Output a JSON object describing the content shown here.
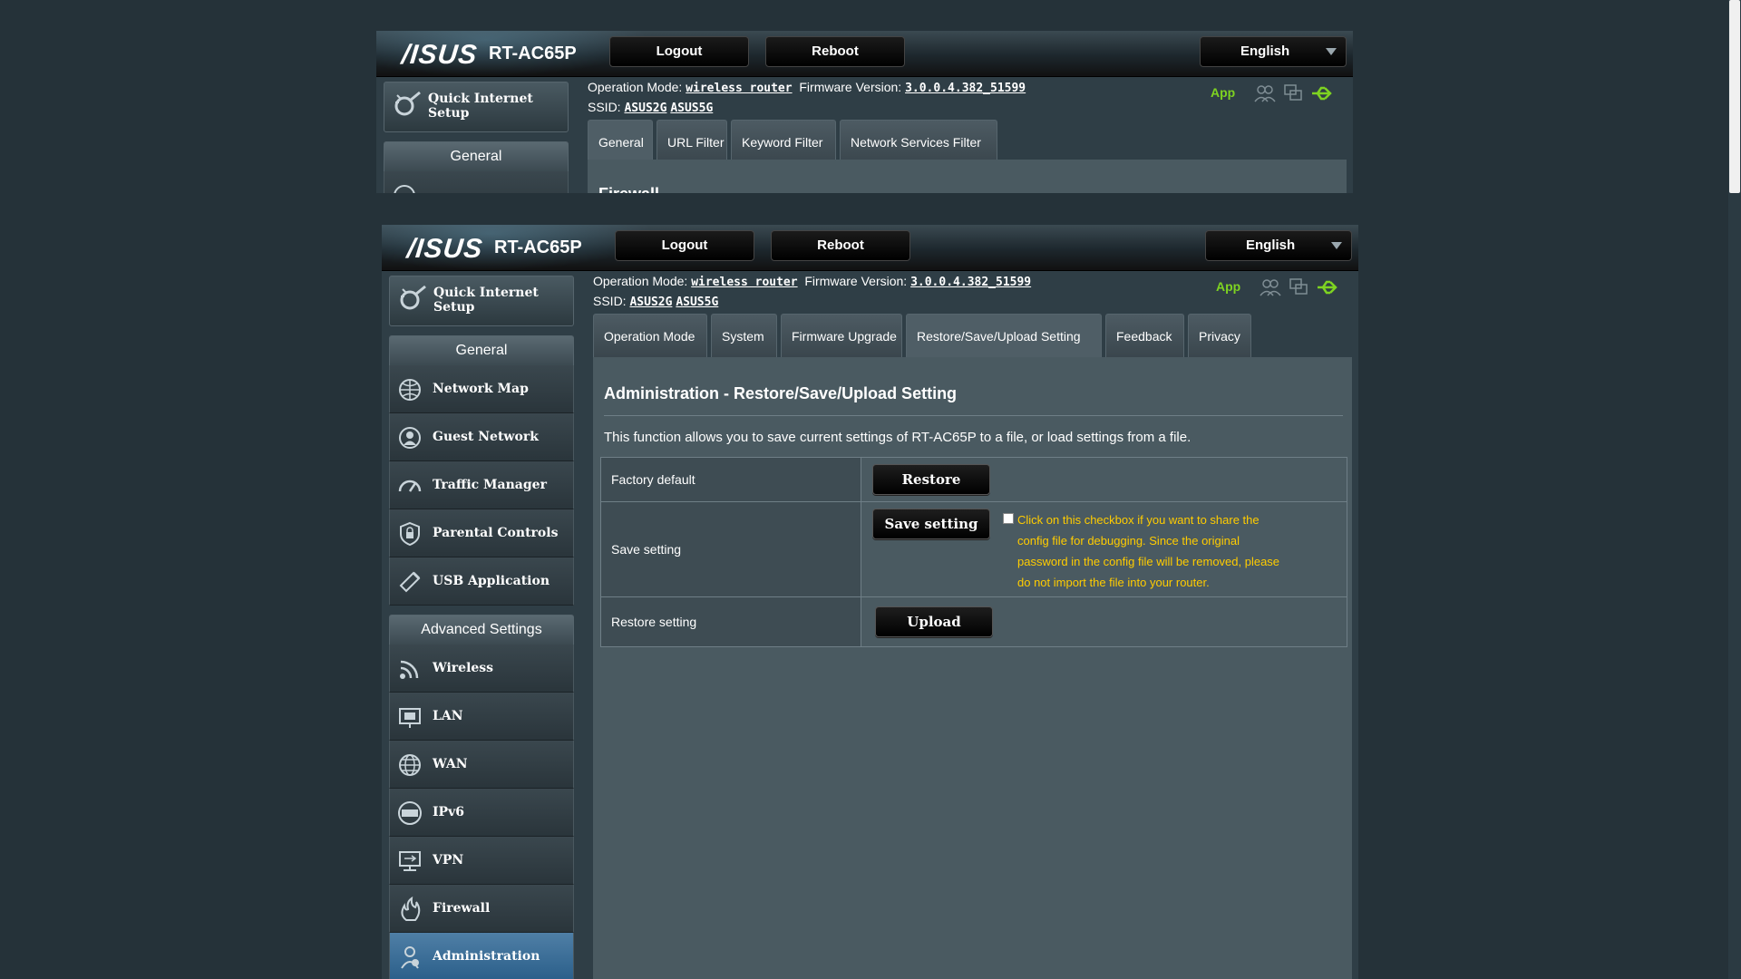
{
  "header": {
    "logo": "/ISUS",
    "model": "RT-AC65P",
    "logout_label": "Logout",
    "reboot_label": "Reboot",
    "language": "English"
  },
  "status": {
    "operation_mode_label": "Operation Mode:",
    "operation_mode_value": "wireless router",
    "firmware_label": "Firmware Version:",
    "firmware_value": "3.0.0.4.382_51599",
    "ssid_label": "SSID:",
    "ssid_1": "ASUS2G",
    "ssid_2": "ASUS5G",
    "app_label": "App"
  },
  "colors": {
    "accent_green": "#7ed321",
    "warning_yellow": "#ffcc00",
    "active_blue": "#2b5f8a"
  },
  "sidebar": {
    "quick_setup": "Quick Internet Setup",
    "general_head": "General",
    "general_items": [
      {
        "label": "Network Map",
        "icon": "network-map-icon"
      },
      {
        "label": "Guest Network",
        "icon": "guest-network-icon"
      },
      {
        "label": "Traffic Manager",
        "icon": "traffic-manager-icon"
      },
      {
        "label": "Parental Controls",
        "icon": "parental-controls-icon"
      },
      {
        "label": "USB Application",
        "icon": "usb-application-icon"
      }
    ],
    "advanced_head": "Advanced Settings",
    "advanced_items": [
      {
        "label": "Wireless",
        "icon": "wireless-icon"
      },
      {
        "label": "LAN",
        "icon": "lan-icon"
      },
      {
        "label": "WAN",
        "icon": "wan-icon"
      },
      {
        "label": "IPv6",
        "icon": "ipv6-icon"
      },
      {
        "label": "VPN",
        "icon": "vpn-icon"
      },
      {
        "label": "Firewall",
        "icon": "firewall-icon"
      },
      {
        "label": "Administration",
        "icon": "administration-icon"
      }
    ]
  },
  "bg_window": {
    "tabs": [
      "General",
      "URL Filter",
      "Keyword Filter",
      "Network Services Filter"
    ],
    "content_title": "Firewall"
  },
  "tabs": [
    "Operation Mode",
    "System",
    "Firmware Upgrade",
    "Restore/Save/Upload Setting",
    "Feedback",
    "Privacy"
  ],
  "page": {
    "title": "Administration - Restore/Save/Upload Setting",
    "description": "This function allows you to save current settings of RT-AC65P to a file, or load settings from a file.",
    "rows": [
      {
        "label": "Factory default",
        "button": "Restore"
      },
      {
        "label": "Save setting",
        "button": "Save setting"
      },
      {
        "label": "Restore setting",
        "button": "Upload"
      }
    ],
    "debug_note": "Click on this checkbox if you want to share the config file for debugging. Since the original password in the config file will be removed, please do not import the file into your router.",
    "debug_checked": false
  }
}
